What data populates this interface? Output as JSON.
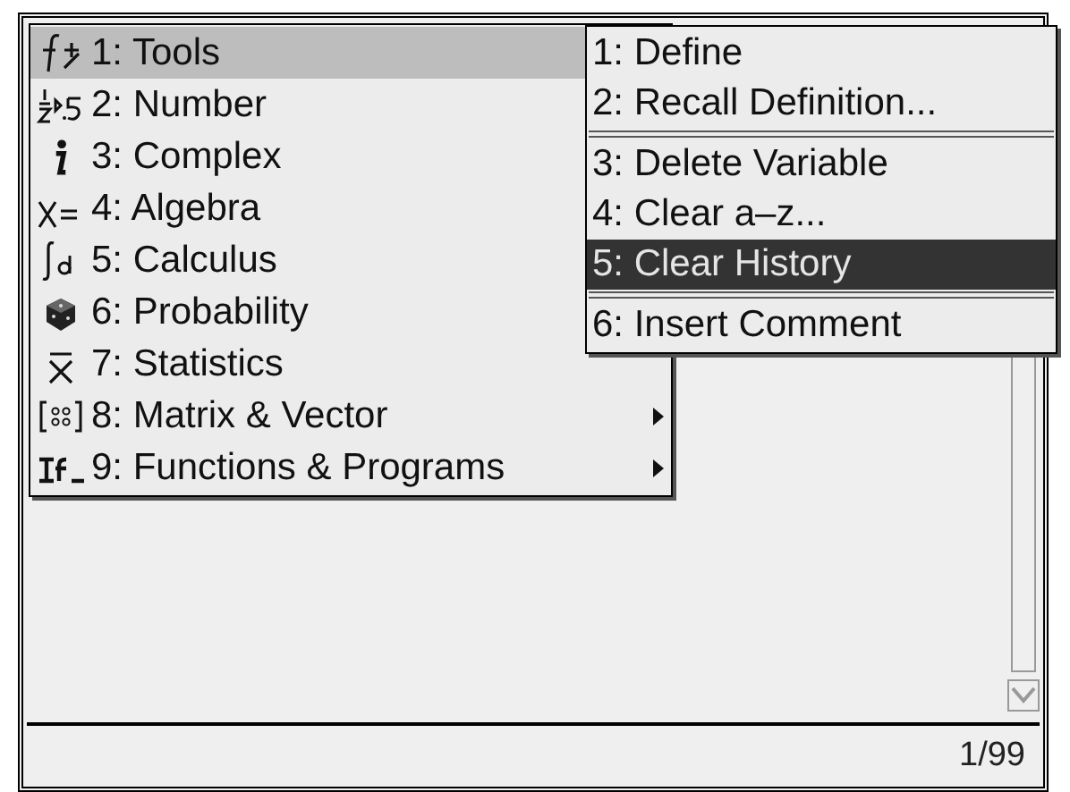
{
  "menu": {
    "items": [
      {
        "label": "1: Tools",
        "selected": true,
        "submenu": false
      },
      {
        "label": "2: Number",
        "selected": false,
        "submenu": false
      },
      {
        "label": "3: Complex",
        "selected": false,
        "submenu": false
      },
      {
        "label": "4: Algebra",
        "selected": false,
        "submenu": false
      },
      {
        "label": "5: Calculus",
        "selected": false,
        "submenu": false
      },
      {
        "label": "6: Probability",
        "selected": false,
        "submenu": false
      },
      {
        "label": "7: Statistics",
        "selected": false,
        "submenu": false
      },
      {
        "label": "8: Matrix & Vector",
        "selected": false,
        "submenu": true
      },
      {
        "label": "9: Functions & Programs",
        "selected": false,
        "submenu": true
      }
    ]
  },
  "submenu": {
    "items": [
      {
        "label": "1: Define",
        "selected": false,
        "separator_after": false
      },
      {
        "label": "2: Recall Definition...",
        "selected": false,
        "separator_after": true
      },
      {
        "label": "3: Delete Variable",
        "selected": false,
        "separator_after": false
      },
      {
        "label": "4: Clear a–z...",
        "selected": false,
        "separator_after": false
      },
      {
        "label": "5: Clear History",
        "selected": true,
        "separator_after": true
      },
      {
        "label": "6: Insert Comment",
        "selected": false,
        "separator_after": false
      }
    ]
  },
  "status_bar": {
    "page": "1/99"
  }
}
